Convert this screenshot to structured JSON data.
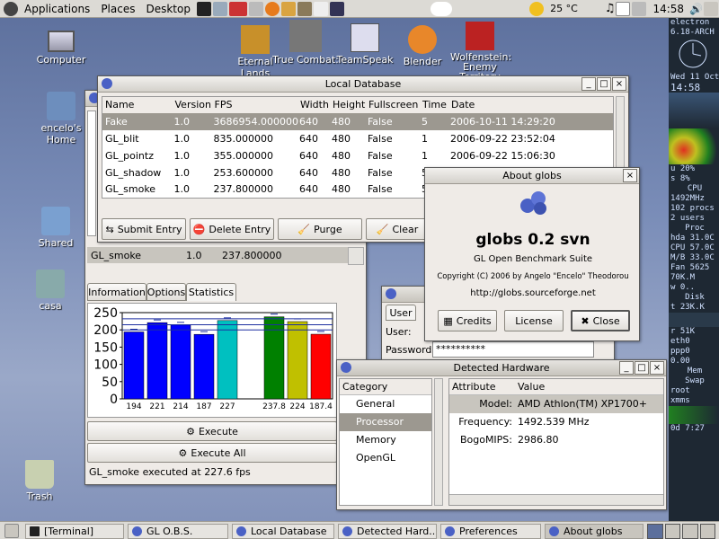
{
  "top_panel": {
    "menus": [
      "Applications",
      "Places",
      "Desktop"
    ],
    "weather": "25 °C",
    "clock": "14:58"
  },
  "desktop_icons": {
    "computer": "Computer",
    "home": "encelo's Home",
    "shared": "Shared",
    "casa": "casa",
    "trash": "Trash",
    "eternal_lands": "Eternal Lands",
    "true_combat": "True Combat:",
    "teamspeak": "TeamSpeak",
    "blender": "Blender",
    "wolfenstein": "Wolfenstein: Enemy Territory"
  },
  "local_db": {
    "title": "Local Database",
    "columns": [
      "Name",
      "Version",
      "FPS",
      "Width",
      "Height",
      "Fullscreen",
      "Time",
      "Date"
    ],
    "rows": [
      [
        "Fake",
        "1.0",
        "3686954.000000",
        "640",
        "480",
        "False",
        "5",
        "2006-10-11 14:29:20"
      ],
      [
        "GL_blit",
        "1.0",
        "835.000000",
        "640",
        "480",
        "False",
        "1",
        "2006-09-22 23:52:04"
      ],
      [
        "GL_pointz",
        "1.0",
        "355.000000",
        "640",
        "480",
        "False",
        "1",
        "2006-09-22 15:06:30"
      ],
      [
        "GL_shadow",
        "1.0",
        "253.600000",
        "640",
        "480",
        "False",
        "5",
        ""
      ],
      [
        "GL_smoke",
        "1.0",
        "237.800000",
        "640",
        "480",
        "False",
        "5",
        ""
      ]
    ],
    "buttons": {
      "submit": "Submit Entry",
      "delete": "Delete Entry",
      "purge": "Purge",
      "clear": "Clear"
    }
  },
  "globs_main": {
    "selected_row": [
      "GL_smoke",
      "1.0",
      "237.800000"
    ],
    "tabs": [
      "Information",
      "Options",
      "Statistics"
    ],
    "execute": "Execute",
    "execute_all": "Execute All",
    "status": "GL_smoke executed at 227.6 fps"
  },
  "chart_data": {
    "type": "bar",
    "categories": [
      "194",
      "221",
      "214",
      "187",
      "227",
      "",
      "237.8",
      "224",
      "187.4"
    ],
    "values": [
      194,
      221,
      214,
      187,
      227,
      0,
      237.8,
      224,
      187.4
    ],
    "colors": [
      "#0000ff",
      "#0000ff",
      "#0000ff",
      "#0000ff",
      "#00c0c0",
      "#ffffff",
      "#008000",
      "#c0c000",
      "#ff0000"
    ],
    "ylim": [
      0,
      250
    ],
    "yticks": [
      0,
      50,
      100,
      150,
      200,
      250
    ]
  },
  "about": {
    "title": "About globs",
    "name": "globs 0.2 svn",
    "subtitle": "GL Open Benchmark Suite",
    "copyright": "Copyright (C) 2006 by Angelo \"Encelo\" Theodorou",
    "url": "http://globs.sourceforge.net",
    "credits": "Credits",
    "license": "License",
    "close": "Close"
  },
  "prefs": {
    "tab": "User",
    "user_label": "User:",
    "password_label": "Password:",
    "password_value": "**********"
  },
  "hardware": {
    "title": "Detected Hardware",
    "cat_header": "Category",
    "categories": [
      "General",
      "Processor",
      "Memory",
      "OpenGL"
    ],
    "attr_header": "Attribute",
    "val_header": "Value",
    "attrs": [
      [
        "Model:",
        "AMD Athlon(TM) XP1700+"
      ],
      [
        "Frequency:",
        "1492.539 MHz"
      ],
      [
        "BogoMIPS:",
        "2986.80"
      ]
    ]
  },
  "taskbar": [
    "[Terminal]",
    "GL O.B.S.",
    "Local Database",
    "Detected Hard...",
    "Preferences",
    "About globs"
  ],
  "conky": {
    "host": "electron",
    "kernel": "6.18-ARCH",
    "date": "Wed 11 Oct",
    "time": "14:58",
    "cpu_use": "u 20%",
    "cpu_sys": "s 8%",
    "cpu": "CPU",
    "freq": "1492MHz",
    "procs": "102 procs",
    "users": "2 users",
    "proc": "Proc",
    "hda": "hda 31.0C",
    "cpu_temp": "CPU 57.0C",
    "mb": "M/B 33.0C",
    "fan": "Fan 5625",
    "mem": "70K.M",
    "w": "w 0..",
    "disk": "Disk",
    "disk_t": "t 23K.K",
    "r": "r 51K",
    "eth0": "eth0",
    "ppp0": "ppp0",
    "net": "0.00",
    "mem_h": "Mem",
    "swap": "Swap",
    "root": "root",
    "xmms": "xmms",
    "uptime": "0d 7:27"
  }
}
